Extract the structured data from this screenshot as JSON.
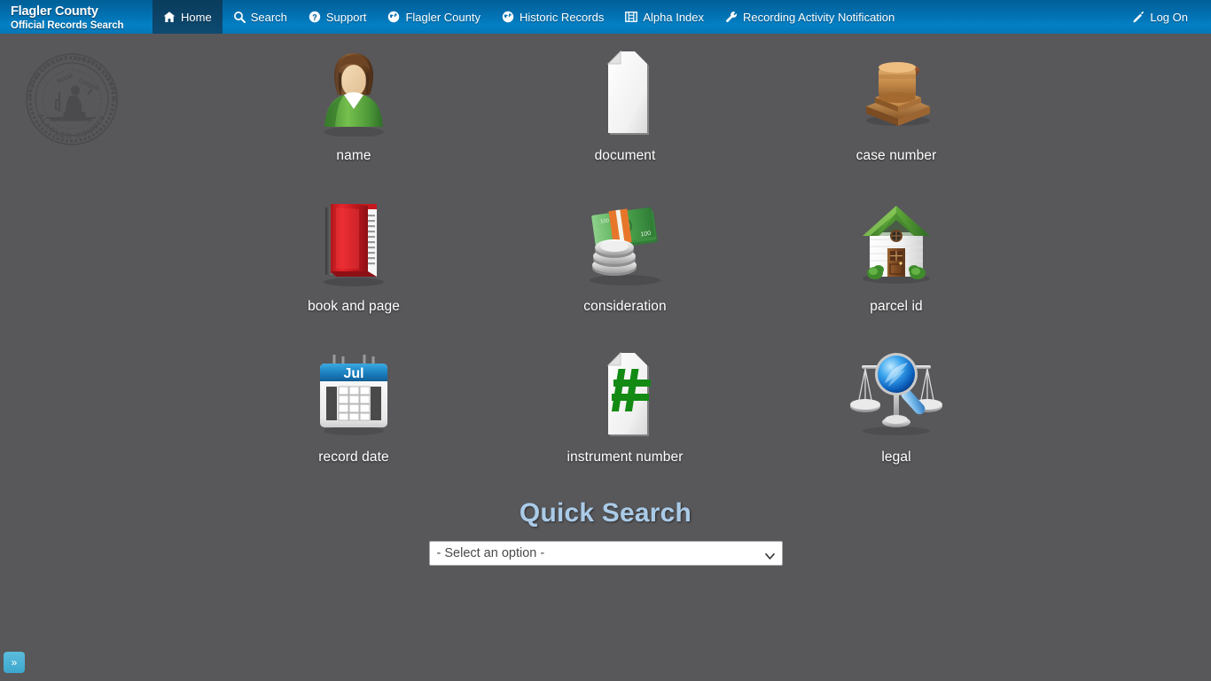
{
  "brand": {
    "line1": "Flagler County",
    "line2": "Official Records Search"
  },
  "nav": {
    "items": [
      {
        "label": "Home",
        "icon": "home-icon",
        "active": true
      },
      {
        "label": "Search",
        "icon": "search-icon",
        "active": false
      },
      {
        "label": "Support",
        "icon": "question-circle-icon",
        "active": false
      },
      {
        "label": "Flagler County",
        "icon": "globe-icon",
        "active": false
      },
      {
        "label": "Historic Records",
        "icon": "globe-icon",
        "active": false
      },
      {
        "label": "Alpha Index",
        "icon": "table-icon",
        "active": false
      },
      {
        "label": "Recording Activity Notification",
        "icon": "wrench-icon",
        "active": false
      }
    ],
    "logon": {
      "label": "Log On",
      "icon": "pencil-icon"
    }
  },
  "seal": {
    "name": "flagler-county-clerk-seal",
    "outer_text_top": "CLERK OF THE CIRCUIT COURT & COMPTROLLER",
    "outer_text_bottom": "FLAGLER COUNTY",
    "motto": "SUUM CUIQUE"
  },
  "tiles": [
    {
      "label": "name",
      "icon": "person-icon"
    },
    {
      "label": "document",
      "icon": "document-icon"
    },
    {
      "label": "case number",
      "icon": "gavel-icon"
    },
    {
      "label": "book and page",
      "icon": "book-icon"
    },
    {
      "label": "consideration",
      "icon": "money-icon"
    },
    {
      "label": "parcel id",
      "icon": "house-icon"
    },
    {
      "label": "record date",
      "icon": "calendar-icon"
    },
    {
      "label": "instrument number",
      "icon": "hash-document-icon"
    },
    {
      "label": "legal",
      "icon": "scales-magnifier-icon"
    }
  ],
  "calendar": {
    "month": "Jul"
  },
  "quick_search": {
    "title": "Quick Search",
    "select_value": "- Select an option -",
    "options": [
      "- Select an option -"
    ]
  },
  "side_toggle": {
    "label": "»"
  },
  "colors": {
    "page_background": "#58585b",
    "nav_blue_top": "#015f96",
    "nav_blue_bottom": "#0376b6",
    "nav_active": "#0b3f61",
    "quick_search_title": "#aacbe8",
    "toggle_blue": "#4db0d4"
  }
}
